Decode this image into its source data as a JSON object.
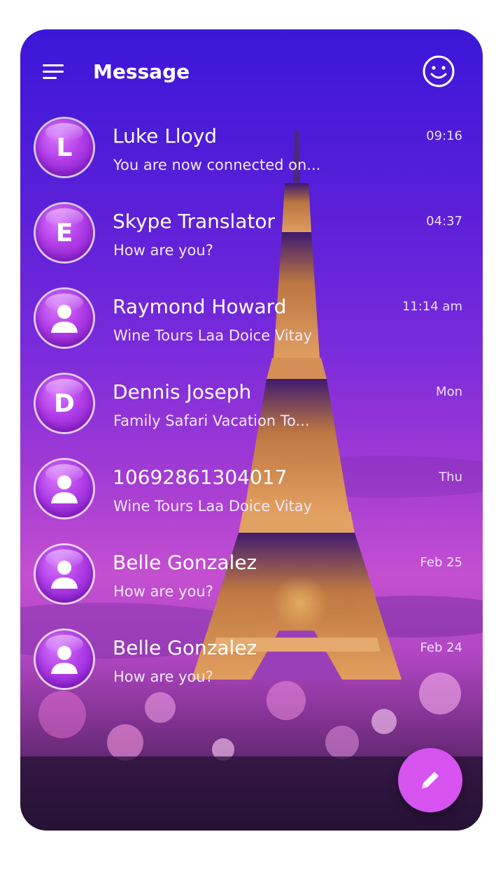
{
  "header": {
    "title": "Message",
    "menu_icon": "menu-icon",
    "profile_icon": "smiley-face-icon"
  },
  "conversations": [
    {
      "avatar": "L",
      "avatar_type": "letter",
      "name": "Luke Lloyd",
      "preview": "You are now connected on...",
      "time": "09:16"
    },
    {
      "avatar": "E",
      "avatar_type": "letter",
      "name": "Skype Translator",
      "preview": "How are you?",
      "time": "04:37"
    },
    {
      "avatar": "",
      "avatar_type": "person-icon",
      "name": "Raymond Howard",
      "preview": "Wine Tours Laa Doice Vitay",
      "time": "11:14 am"
    },
    {
      "avatar": "D",
      "avatar_type": "letter",
      "name": "Dennis Joseph",
      "preview": "Family Safari Vacation To...",
      "time": "Mon"
    },
    {
      "avatar": "",
      "avatar_type": "person-icon",
      "name": "10692861304017",
      "preview": "Wine Tours Laa Doice Vitay",
      "time": "Thu"
    },
    {
      "avatar": "",
      "avatar_type": "person-icon",
      "name": "Belle Gonzalez",
      "preview": "How are you?",
      "time": "Feb 25"
    },
    {
      "avatar": "",
      "avatar_type": "person-icon",
      "name": "Belle Gonzalez",
      "preview": "How are you?",
      "time": "Feb 24"
    }
  ],
  "fab": {
    "icon": "pencil-icon"
  },
  "colors": {
    "accent": "#d653f0",
    "avatar": "#b23ee8",
    "text": "#ffffff"
  }
}
